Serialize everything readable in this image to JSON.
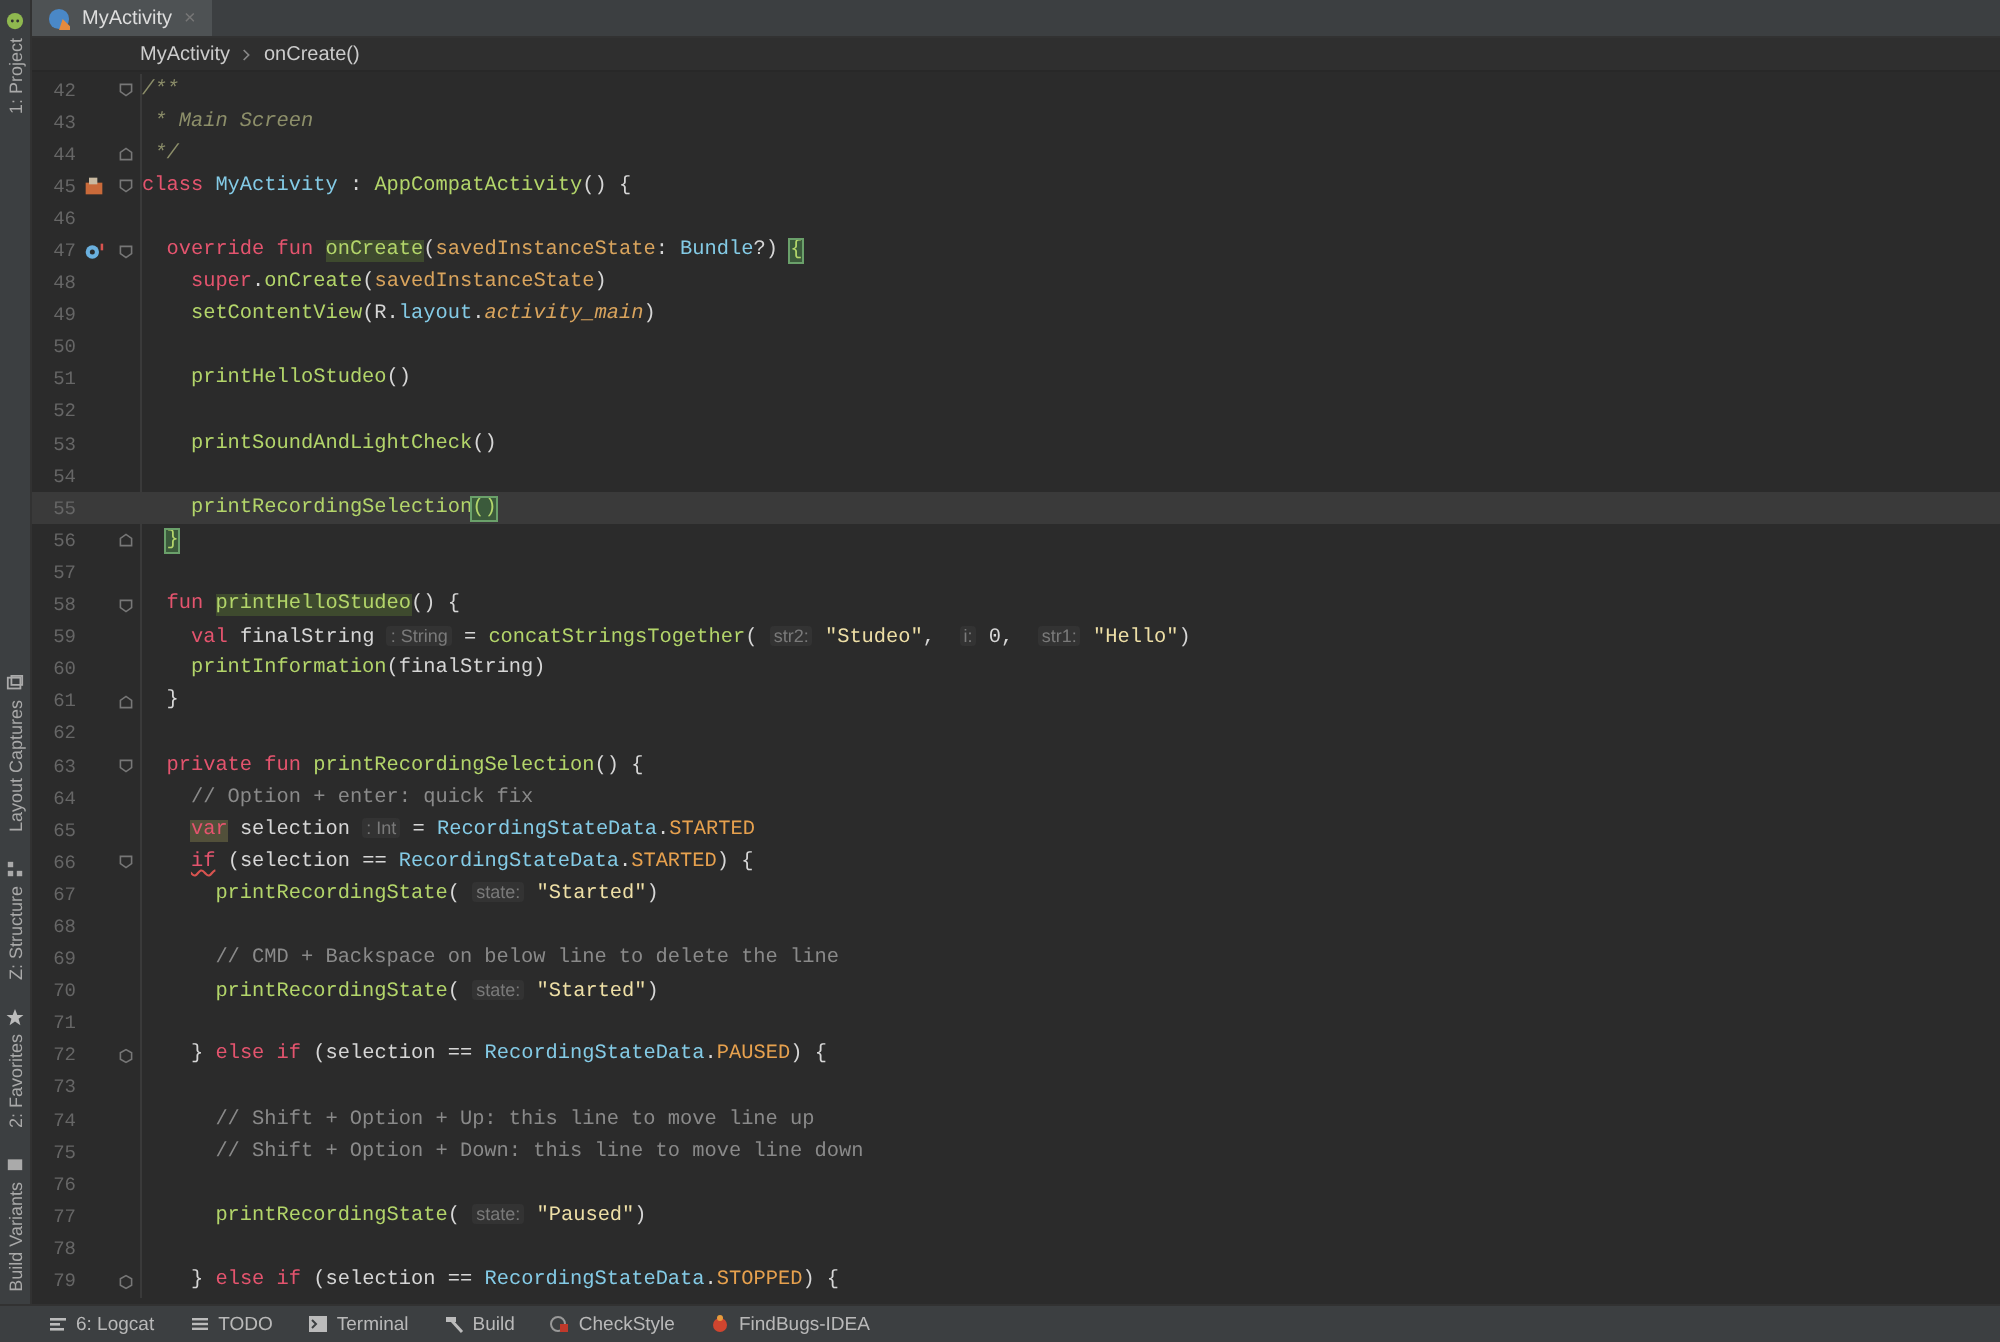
{
  "left_strip": {
    "top": [
      {
        "label": "1: Project"
      }
    ],
    "bottom": [
      {
        "label": "Layout Captures"
      },
      {
        "label": "Z: Structure"
      },
      {
        "label": "2: Favorites"
      },
      {
        "label": "Build Variants"
      }
    ]
  },
  "tabs": [
    {
      "label": "MyActivity",
      "selected": true,
      "close": "×"
    }
  ],
  "breadcrumb": [
    "MyActivity",
    "onCreate()"
  ],
  "lines": [
    {
      "n": "42",
      "fold_open": true,
      "fold_close": false,
      "current": false,
      "toks": [
        {
          "kind": "doc",
          "t": "/**"
        }
      ]
    },
    {
      "n": "43",
      "fold_open": false,
      "fold_close": false,
      "current": false,
      "toks": [
        {
          "kind": "doc",
          "t": " * Main Screen"
        }
      ]
    },
    {
      "n": "44",
      "fold_open": false,
      "fold_close": true,
      "current": false,
      "toks": [
        {
          "kind": "doc",
          "t": " */"
        }
      ]
    },
    {
      "n": "45",
      "fold_open": true,
      "fold_close": false,
      "current": false,
      "marker": {
        "kind": "class"
      },
      "toks": [
        {
          "kind": "kw",
          "t": "class "
        },
        {
          "kind": "cls",
          "t": "MyActivity"
        },
        {
          "kind": "plain",
          "t": " : "
        },
        {
          "kind": "fn",
          "t": "AppCompatActivity"
        },
        {
          "kind": "plain",
          "t": "() {"
        }
      ]
    },
    {
      "n": "46",
      "fold_open": false,
      "fold_close": false,
      "current": false
    },
    {
      "n": "47",
      "fold_open": true,
      "fold_close": false,
      "current": false,
      "marker": {
        "kind": "override"
      },
      "toks": [
        {
          "kind": "kw",
          "t": "  override fun "
        },
        {
          "kind": "usage",
          "t": "onCreate"
        },
        {
          "kind": "plain",
          "t": "("
        },
        {
          "kind": "param",
          "t": "savedInstanceState"
        },
        {
          "kind": "plain",
          "t": ": "
        },
        {
          "kind": "cls",
          "t": "Bundle"
        },
        {
          "kind": "plain",
          "t": "?)"
        },
        {
          "kind": "match",
          "t": " {"
        }
      ]
    },
    {
      "n": "48",
      "fold_open": false,
      "fold_close": false,
      "current": false,
      "toks": [
        {
          "kind": "kw",
          "t": "    super"
        },
        {
          "kind": "plain",
          "t": "."
        },
        {
          "kind": "fn",
          "t": "onCreate"
        },
        {
          "kind": "plain",
          "t": "("
        },
        {
          "kind": "param",
          "t": "savedInstanceState"
        },
        {
          "kind": "plain",
          "t": ")"
        }
      ]
    },
    {
      "n": "49",
      "fold_open": false,
      "fold_close": false,
      "current": false,
      "toks": [
        {
          "kind": "fn",
          "t": "    setContentView"
        },
        {
          "kind": "plain",
          "t": "(R."
        },
        {
          "kind": "cls",
          "t": "layout"
        },
        {
          "kind": "plain",
          "t": "."
        },
        {
          "kind": "field",
          "t": "activity_main"
        },
        {
          "kind": "plain",
          "t": ")"
        }
      ]
    },
    {
      "n": "50",
      "fold_open": false,
      "fold_close": false,
      "current": false
    },
    {
      "n": "51",
      "fold_open": false,
      "fold_close": false,
      "current": false,
      "toks": [
        {
          "kind": "fn",
          "t": "    printHelloStudeo"
        },
        {
          "kind": "plain",
          "t": "()"
        }
      ]
    },
    {
      "n": "52",
      "fold_open": false,
      "fold_close": false,
      "current": false
    },
    {
      "n": "53",
      "fold_open": false,
      "fold_close": false,
      "current": false,
      "toks": [
        {
          "kind": "fn",
          "t": "    printSoundAndLightCheck"
        },
        {
          "kind": "plain",
          "t": "()"
        }
      ]
    },
    {
      "n": "54",
      "fold_open": false,
      "fold_close": false,
      "current": false
    },
    {
      "n": "55",
      "fold_open": false,
      "fold_close": false,
      "current": true,
      "toks": [
        {
          "kind": "fn",
          "t": "    printRecordingSelection"
        },
        {
          "kind": "match",
          "t": "()"
        }
      ]
    },
    {
      "n": "56",
      "fold_open": false,
      "fold_close": true,
      "current": false,
      "toks": [
        {
          "kind": "match",
          "t": "  }"
        }
      ]
    },
    {
      "n": "57",
      "fold_open": false,
      "fold_close": false,
      "current": false
    },
    {
      "n": "58",
      "fold_open": true,
      "fold_close": false,
      "current": false,
      "toks": [
        {
          "kind": "kw",
          "t": "  fun "
        },
        {
          "kind": "usage",
          "t": "printHelloStudeo"
        },
        {
          "kind": "plain",
          "t": "() {"
        }
      ]
    },
    {
      "n": "59",
      "fold_open": false,
      "fold_close": false,
      "current": false,
      "toks": [
        {
          "kind": "kw",
          "t": "    val"
        },
        {
          "kind": "plain",
          "t": " finalString"
        },
        {
          "kind": "hint",
          "t": " : String"
        },
        {
          "kind": "plain",
          "t": " = "
        },
        {
          "kind": "fn",
          "t": "concatStringsTogether"
        },
        {
          "kind": "plain",
          "t": "("
        },
        {
          "kind": "hint",
          "t": " str2:"
        },
        {
          "kind": "str",
          "t": " \"Studeo\""
        },
        {
          "kind": "plain",
          "t": ","
        },
        {
          "kind": "hint",
          "t": "  i:"
        },
        {
          "kind": "plain",
          "t": " 0,"
        },
        {
          "kind": "hint",
          "t": "  str1:"
        },
        {
          "kind": "str",
          "t": " \"Hello\""
        },
        {
          "kind": "plain",
          "t": ")"
        }
      ]
    },
    {
      "n": "60",
      "fold_open": false,
      "fold_close": false,
      "current": false,
      "toks": [
        {
          "kind": "fn",
          "t": "    printInformation"
        },
        {
          "kind": "plain",
          "t": "(finalString)"
        }
      ]
    },
    {
      "n": "61",
      "fold_open": false,
      "fold_close": true,
      "current": false,
      "toks": [
        {
          "kind": "plain",
          "t": "  }"
        }
      ]
    },
    {
      "n": "62",
      "fold_open": false,
      "fold_close": false,
      "current": false
    },
    {
      "n": "63",
      "fold_open": true,
      "fold_close": false,
      "current": false,
      "toks": [
        {
          "kind": "kw",
          "t": "  private fun "
        },
        {
          "kind": "fn",
          "t": "printRecordingSelection"
        },
        {
          "kind": "plain",
          "t": "() {"
        }
      ]
    },
    {
      "n": "64",
      "fold_open": false,
      "fold_close": false,
      "current": false,
      "toks": [
        {
          "kind": "comment",
          "t": "    // Option + enter: quick fix"
        }
      ]
    },
    {
      "n": "65",
      "fold_open": false,
      "fold_close": false,
      "current": false,
      "toks": [
        {
          "kind": "warn",
          "t": "    var"
        },
        {
          "kind": "plain",
          "t": " selection"
        },
        {
          "kind": "hint",
          "t": " : Int"
        },
        {
          "kind": "plain",
          "t": " = "
        },
        {
          "kind": "cls",
          "t": "RecordingStateData"
        },
        {
          "kind": "plain",
          "t": "."
        },
        {
          "kind": "const",
          "t": "STARTED"
        }
      ]
    },
    {
      "n": "66",
      "fold_open": true,
      "fold_close": false,
      "current": false,
      "toks": [
        {
          "kind": "err",
          "t": "    if"
        },
        {
          "kind": "plain",
          "t": " (selection == "
        },
        {
          "kind": "cls",
          "t": "RecordingStateData"
        },
        {
          "kind": "plain",
          "t": "."
        },
        {
          "kind": "const",
          "t": "STARTED"
        },
        {
          "kind": "plain",
          "t": ") {"
        }
      ]
    },
    {
      "n": "67",
      "fold_open": false,
      "fold_close": false,
      "current": false,
      "toks": [
        {
          "kind": "fn",
          "t": "      printRecordingState"
        },
        {
          "kind": "plain",
          "t": "("
        },
        {
          "kind": "hint",
          "t": " state:"
        },
        {
          "kind": "str",
          "t": " \"Started\""
        },
        {
          "kind": "plain",
          "t": ")"
        }
      ]
    },
    {
      "n": "68",
      "fold_open": false,
      "fold_close": false,
      "current": false
    },
    {
      "n": "69",
      "fold_open": false,
      "fold_close": false,
      "current": false,
      "toks": [
        {
          "kind": "comment",
          "t": "      // CMD + Backspace on below line to delete the line"
        }
      ]
    },
    {
      "n": "70",
      "fold_open": false,
      "fold_close": false,
      "current": false,
      "toks": [
        {
          "kind": "fn",
          "t": "      printRecordingState"
        },
        {
          "kind": "plain",
          "t": "("
        },
        {
          "kind": "hint",
          "t": " state:"
        },
        {
          "kind": "str",
          "t": " \"Started\""
        },
        {
          "kind": "plain",
          "t": ")"
        }
      ]
    },
    {
      "n": "71",
      "fold_open": false,
      "fold_close": false,
      "current": false
    },
    {
      "n": "72",
      "fold_open": true,
      "fold_close": true,
      "current": false,
      "toks": [
        {
          "kind": "plain",
          "t": "    }"
        },
        {
          "kind": "kw",
          "t": " else if"
        },
        {
          "kind": "plain",
          "t": " (selection == "
        },
        {
          "kind": "cls",
          "t": "RecordingStateData"
        },
        {
          "kind": "plain",
          "t": "."
        },
        {
          "kind": "const",
          "t": "PAUSED"
        },
        {
          "kind": "plain",
          "t": ") {"
        }
      ]
    },
    {
      "n": "73",
      "fold_open": false,
      "fold_close": false,
      "current": false
    },
    {
      "n": "74",
      "fold_open": false,
      "fold_close": false,
      "current": false,
      "toks": [
        {
          "kind": "comment",
          "t": "      // Shift + Option + Up: this line to move line up"
        }
      ]
    },
    {
      "n": "75",
      "fold_open": false,
      "fold_close": false,
      "current": false,
      "toks": [
        {
          "kind": "comment",
          "t": "      // Shift + Option + Down: this line to move line down"
        }
      ]
    },
    {
      "n": "76",
      "fold_open": false,
      "fold_close": false,
      "current": false
    },
    {
      "n": "77",
      "fold_open": false,
      "fold_close": false,
      "current": false,
      "toks": [
        {
          "kind": "fn",
          "t": "      printRecordingState"
        },
        {
          "kind": "plain",
          "t": "("
        },
        {
          "kind": "hint",
          "t": " state:"
        },
        {
          "kind": "str",
          "t": " \"Paused\""
        },
        {
          "kind": "plain",
          "t": ")"
        }
      ]
    },
    {
      "n": "78",
      "fold_open": false,
      "fold_close": false,
      "current": false
    },
    {
      "n": "79",
      "fold_open": true,
      "fold_close": true,
      "current": false,
      "toks": [
        {
          "kind": "plain",
          "t": "    }"
        },
        {
          "kind": "kw",
          "t": " else if"
        },
        {
          "kind": "plain",
          "t": " (selection == "
        },
        {
          "kind": "cls",
          "t": "RecordingStateData"
        },
        {
          "kind": "plain",
          "t": "."
        },
        {
          "kind": "const",
          "t": "STOPPED"
        },
        {
          "kind": "plain",
          "t": ") {"
        }
      ]
    }
  ],
  "bottom_bar": [
    {
      "label": "6: Logcat"
    },
    {
      "label": "TODO"
    },
    {
      "label": "Terminal"
    },
    {
      "label": "Build"
    },
    {
      "label": "CheckStyle"
    },
    {
      "label": "FindBugs-IDEA"
    }
  ]
}
